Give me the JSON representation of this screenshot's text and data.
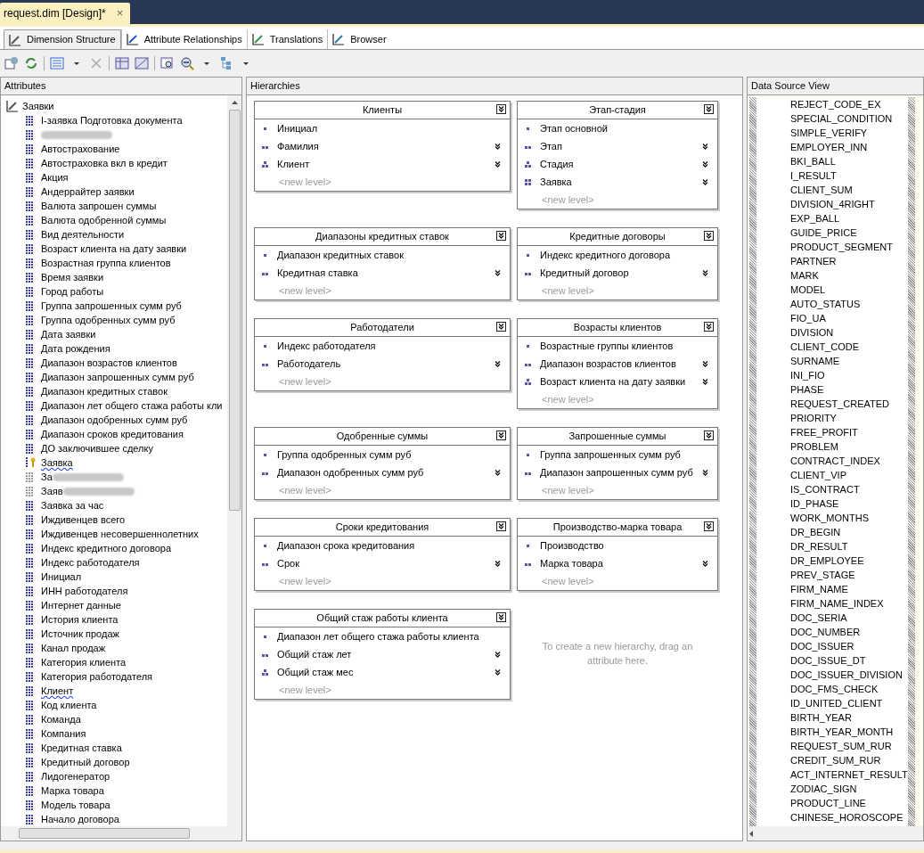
{
  "document_tab": {
    "title": "request.dim [Design]*",
    "close": "×"
  },
  "tabs": [
    {
      "label": "Dimension Structure",
      "selected": true
    },
    {
      "label": "Attribute Relationships",
      "selected": false
    },
    {
      "label": "Translations",
      "selected": false
    },
    {
      "label": "Browser",
      "selected": false
    }
  ],
  "panels": {
    "attributes": "Attributes",
    "hierarchies": "Hierarchies",
    "data_source_view": "Data Source View"
  },
  "attributes": {
    "root": "Заявки",
    "items": [
      {
        "label": "I-заявка Подготовка документа",
        "kind": "attribute",
        "flagged": false
      },
      {
        "kind": "redacted"
      },
      {
        "label": "Автострахование",
        "kind": "attribute",
        "flagged": false
      },
      {
        "label": "Автостраховка вкл в кредит",
        "kind": "attribute",
        "flagged": false
      },
      {
        "label": "Акция",
        "kind": "attribute",
        "flagged": false
      },
      {
        "label": "Андеррайтер заявки",
        "kind": "attribute",
        "flagged": false
      },
      {
        "label": "Валюта запрошен суммы",
        "kind": "attribute",
        "flagged": false
      },
      {
        "label": "Валюта одобренной суммы",
        "kind": "attribute",
        "flagged": false
      },
      {
        "label": "Вид деятельности",
        "kind": "attribute",
        "flagged": false
      },
      {
        "label": "Возраст клиента на дату заявки",
        "kind": "attribute",
        "flagged": false
      },
      {
        "label": "Возрастная группа клиентов",
        "kind": "attribute",
        "flagged": false
      },
      {
        "label": "Время заявки",
        "kind": "attribute",
        "flagged": false
      },
      {
        "label": "Город работы",
        "kind": "attribute",
        "flagged": false
      },
      {
        "label": "Группа запрошенных сумм руб",
        "kind": "attribute",
        "flagged": false
      },
      {
        "label": "Группа одобренных сумм руб",
        "kind": "attribute",
        "flagged": false
      },
      {
        "label": "Дата заявки",
        "kind": "attribute",
        "flagged": false
      },
      {
        "label": "Дата рождения",
        "kind": "attribute",
        "flagged": false
      },
      {
        "label": "Диапазон возрастов клиентов",
        "kind": "attribute",
        "flagged": false
      },
      {
        "label": "Диапазон запрошенных сумм руб",
        "kind": "attribute",
        "flagged": false
      },
      {
        "label": "Диапазон кредитных ставок",
        "kind": "attribute",
        "flagged": false
      },
      {
        "label": "Диапазон лет общего стажа работы кли",
        "kind": "attribute",
        "flagged": false
      },
      {
        "label": "Диапазон одобренных сумм руб",
        "kind": "attribute",
        "flagged": false
      },
      {
        "label": "Диапазон сроков кредитования",
        "kind": "attribute",
        "flagged": false
      },
      {
        "label": "ДО заключившее сделку",
        "kind": "attribute",
        "flagged": false
      },
      {
        "label": "Заявка",
        "kind": "key",
        "flagged": true
      },
      {
        "label": "За",
        "kind": "hidden_redacted",
        "flagged": false
      },
      {
        "label": "Заяв",
        "kind": "hidden_redacted",
        "flagged": false
      },
      {
        "label": "Заявка за час",
        "kind": "attribute",
        "flagged": false
      },
      {
        "label": "Иждивенцев всего",
        "kind": "attribute",
        "flagged": false
      },
      {
        "label": "Иждивенцев несовершеннолетних",
        "kind": "attribute",
        "flagged": false
      },
      {
        "label": "Индекс кредитного договора",
        "kind": "attribute",
        "flagged": false
      },
      {
        "label": "Индекс работодателя",
        "kind": "attribute",
        "flagged": false
      },
      {
        "label": "Инициал",
        "kind": "attribute",
        "flagged": false
      },
      {
        "label": "ИНН работодателя",
        "kind": "attribute",
        "flagged": false
      },
      {
        "label": "Интернет данные",
        "kind": "attribute",
        "flagged": false
      },
      {
        "label": "История клиента",
        "kind": "attribute",
        "flagged": false
      },
      {
        "label": "Источник продаж",
        "kind": "attribute",
        "flagged": false
      },
      {
        "label": "Канал продаж",
        "kind": "attribute",
        "flagged": false
      },
      {
        "label": "Категория клиента",
        "kind": "attribute",
        "flagged": false
      },
      {
        "label": "Категория работодателя",
        "kind": "attribute",
        "flagged": false
      },
      {
        "label": "Клиент",
        "kind": "attribute",
        "flagged": true
      },
      {
        "label": "Код клиента",
        "kind": "attribute",
        "flagged": false
      },
      {
        "label": "Команда",
        "kind": "attribute",
        "flagged": false
      },
      {
        "label": "Компания",
        "kind": "attribute",
        "flagged": false
      },
      {
        "label": "Кредитная ставка",
        "kind": "attribute",
        "flagged": false
      },
      {
        "label": "Кредитный договор",
        "kind": "attribute",
        "flagged": false
      },
      {
        "label": "Лидогенератор",
        "kind": "attribute",
        "flagged": false
      },
      {
        "label": "Марка товара",
        "kind": "attribute",
        "flagged": false
      },
      {
        "label": "Модель товара",
        "kind": "attribute",
        "flagged": false
      },
      {
        "label": "Начало договора",
        "kind": "attribute",
        "flagged": false
      }
    ]
  },
  "hierarchies": [
    {
      "title": "Клиенты",
      "levels": [
        {
          "label": "Инициал",
          "kind": "level1",
          "expand": false
        },
        {
          "label": "Фамилия",
          "kind": "level2",
          "expand": true
        },
        {
          "label": "Клиент",
          "kind": "level3",
          "expand": true
        }
      ],
      "new_level": "<new level>"
    },
    {
      "title": "Этап-стадия",
      "levels": [
        {
          "label": "Этап основной",
          "kind": "level1",
          "expand": false
        },
        {
          "label": "Этап",
          "kind": "level2",
          "expand": true
        },
        {
          "label": "Стадия",
          "kind": "level3",
          "expand": true
        },
        {
          "label": "Заявка",
          "kind": "level4",
          "expand": true
        }
      ],
      "new_level": "<new level>"
    },
    {
      "title": "Диапазоны кредитных ставок",
      "levels": [
        {
          "label": "Диапазон кредитных ставок",
          "kind": "level1",
          "expand": false
        },
        {
          "label": "Кредитная ставка",
          "kind": "level2",
          "expand": true
        }
      ],
      "new_level": "<new level>"
    },
    {
      "title": "Кредитные договоры",
      "levels": [
        {
          "label": "Индекс кредитного договора",
          "kind": "level1",
          "expand": false
        },
        {
          "label": "Кредитный договор",
          "kind": "level2",
          "expand": true
        }
      ],
      "new_level": "<new level>"
    },
    {
      "title": "Работодатели",
      "levels": [
        {
          "label": "Индекс работодателя",
          "kind": "level1",
          "expand": false
        },
        {
          "label": "Работодатель",
          "kind": "level2",
          "expand": true
        }
      ],
      "new_level": "<new level>"
    },
    {
      "title": "Возрасты клиентов",
      "levels": [
        {
          "label": "Возрастные группы клиентов",
          "kind": "level1",
          "expand": false
        },
        {
          "label": "Диапазон возрастов клиентов",
          "kind": "level2",
          "expand": true
        },
        {
          "label": "Возраст клиента на дату заявки",
          "kind": "level3",
          "expand": true
        }
      ],
      "new_level": "<new level>"
    },
    {
      "title": "Одобренные суммы",
      "levels": [
        {
          "label": "Группа одобренных сумм руб",
          "kind": "level1",
          "expand": false
        },
        {
          "label": "Диапазон одобренных сумм руб",
          "kind": "level2",
          "expand": true
        }
      ],
      "new_level": "<new level>"
    },
    {
      "title": "Запрошенные суммы",
      "levels": [
        {
          "label": "Группа запрошенных сумм руб",
          "kind": "level1",
          "expand": false
        },
        {
          "label": "Диапазон запрошенных сумм руб",
          "kind": "level2",
          "expand": true
        }
      ],
      "new_level": "<new level>"
    },
    {
      "title": "Сроки кредитования",
      "levels": [
        {
          "label": "Диапазон срока кредитования",
          "kind": "level1",
          "expand": false
        },
        {
          "label": "Срок",
          "kind": "level2",
          "expand": true
        }
      ],
      "new_level": "<new level>"
    },
    {
      "title": "Производство-марка товара",
      "levels": [
        {
          "label": "Производство",
          "kind": "level1",
          "expand": false
        },
        {
          "label": "Марка товара",
          "kind": "level2",
          "expand": true
        }
      ],
      "new_level": "<new level>"
    },
    {
      "title": "Общий стаж работы клиента",
      "levels": [
        {
          "label": "Диапазон лет общего стажа работы клиента",
          "kind": "level1",
          "expand": false
        },
        {
          "label": "Общий стаж лет",
          "kind": "level2",
          "expand": true
        },
        {
          "label": "Общий стаж мес",
          "kind": "level3",
          "expand": true
        }
      ],
      "new_level": "<new level>"
    }
  ],
  "hierarchy_hint": "To create a new hierarchy, drag an attribute here.",
  "dsv_columns": [
    "REJECT_CODE_EX",
    "SPECIAL_CONDITION",
    "SIMPLE_VERIFY",
    "EMPLOYER_INN",
    "BKI_BALL",
    "I_RESULT",
    "CLIENT_SUM",
    "DIVISION_4RIGHT",
    "EXP_BALL",
    "GUIDE_PRICE",
    "PRODUCT_SEGMENT",
    "PARTNER",
    "MARK",
    "MODEL",
    "AUTO_STATUS",
    "FIO_UA",
    "DIVISION",
    "CLIENT_CODE",
    "SURNAME",
    "INI_FIO",
    "PHASE",
    "REQUEST_CREATED",
    "PRIORITY",
    "FREE_PROFIT",
    "PROBLEM",
    "CONTRACT_INDEX",
    "CLIENT_VIP",
    "IS_CONTRACT",
    "ID_PHASE",
    "WORK_MONTHS",
    "DR_BEGIN",
    "DR_RESULT",
    "DR_EMPLOYEE",
    "PREV_STAGE",
    "FIRM_NAME",
    "FIRM_NAME_INDEX",
    "DOC_SERIA",
    "DOC_NUMBER",
    "DOC_ISSUER",
    "DOC_ISSUE_DT",
    "DOC_ISSUER_DIVISION",
    "DOC_FMS_CHECK",
    "ID_UNITED_CLIENT",
    "BIRTH_YEAR",
    "BIRTH_YEAR_MONTH",
    "REQUEST_SUM_RUR",
    "CREDIT_SUM_RUR",
    "ACT_INTERNET_RESULT",
    "ZODIAC_SIGN",
    "PRODUCT_LINE",
    "CHINESE_HOROSCOPE"
  ]
}
